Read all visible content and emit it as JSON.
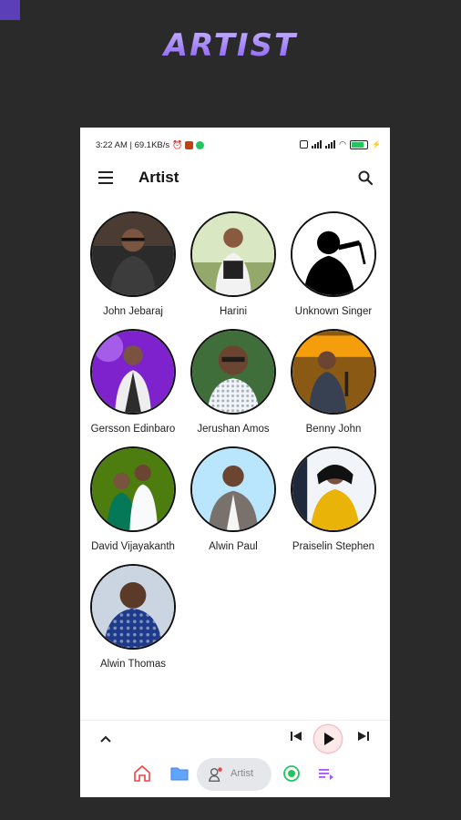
{
  "banner": {
    "text": "ARTIST"
  },
  "status": {
    "time_info": "3:22 AM | 69.1KB/s"
  },
  "appbar": {
    "title": "Artist"
  },
  "artists": [
    {
      "name": "John Jebaraj"
    },
    {
      "name": "Harini"
    },
    {
      "name": "Unknown Singer"
    },
    {
      "name": "Gersson Edinbaro"
    },
    {
      "name": "Jerushan Amos"
    },
    {
      "name": "Benny John"
    },
    {
      "name": "David Vijayakanth"
    },
    {
      "name": "Alwin Paul"
    },
    {
      "name": "Praiselin Stephen"
    },
    {
      "name": "Alwin Thomas"
    }
  ],
  "nav": {
    "active_label": "Artist"
  },
  "colors": {
    "accent": "#8b5cf6",
    "play_bg": "#fde8ea",
    "home": "#ef4444",
    "folder": "#3b82f6",
    "radio": "#22c55e",
    "queue": "#a855f7"
  },
  "icons": [
    "menu-icon",
    "search-icon",
    "chevron-up-icon",
    "skip-previous-icon",
    "play-icon",
    "skip-next-icon",
    "home-icon",
    "folder-icon",
    "artist-icon",
    "radio-icon",
    "queue-icon"
  ]
}
